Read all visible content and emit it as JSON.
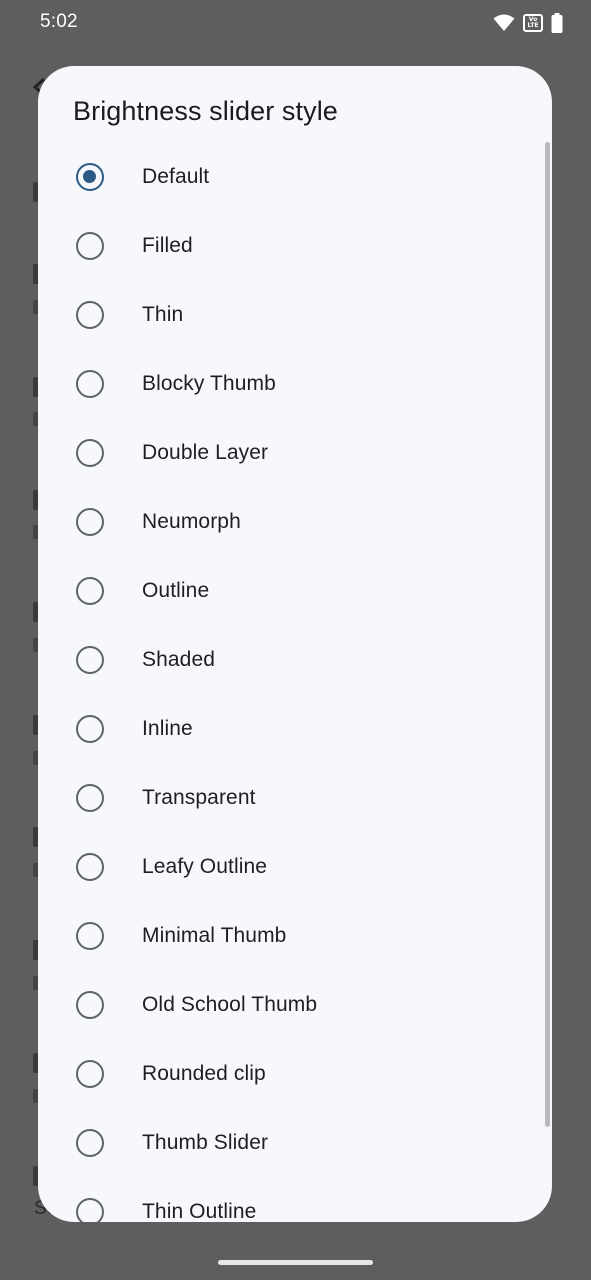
{
  "status_bar": {
    "time": "5:02",
    "volte_label": "Vo LTE",
    "icons": [
      "wifi-icon",
      "volte-icon",
      "battery-icon"
    ]
  },
  "background": {
    "bottom_text": "So"
  },
  "dialog": {
    "title": "Brightness slider style",
    "selected_index": 0,
    "options": [
      {
        "label": "Default",
        "checked": true
      },
      {
        "label": "Filled",
        "checked": false
      },
      {
        "label": "Thin",
        "checked": false
      },
      {
        "label": "Blocky Thumb",
        "checked": false
      },
      {
        "label": "Double Layer",
        "checked": false
      },
      {
        "label": "Neumorph",
        "checked": false
      },
      {
        "label": "Outline",
        "checked": false
      },
      {
        "label": "Shaded",
        "checked": false
      },
      {
        "label": "Inline",
        "checked": false
      },
      {
        "label": "Transparent",
        "checked": false
      },
      {
        "label": "Leafy Outline",
        "checked": false
      },
      {
        "label": "Minimal Thumb",
        "checked": false
      },
      {
        "label": "Old School Thumb",
        "checked": false
      },
      {
        "label": "Rounded clip",
        "checked": false
      },
      {
        "label": "Thumb Slider",
        "checked": false
      },
      {
        "label": "Thin Outline",
        "checked": false
      }
    ]
  },
  "colors": {
    "accent": "#2b5b84",
    "dialog_bg": "#f6f8fc",
    "scrim": "#5e5e5e"
  }
}
